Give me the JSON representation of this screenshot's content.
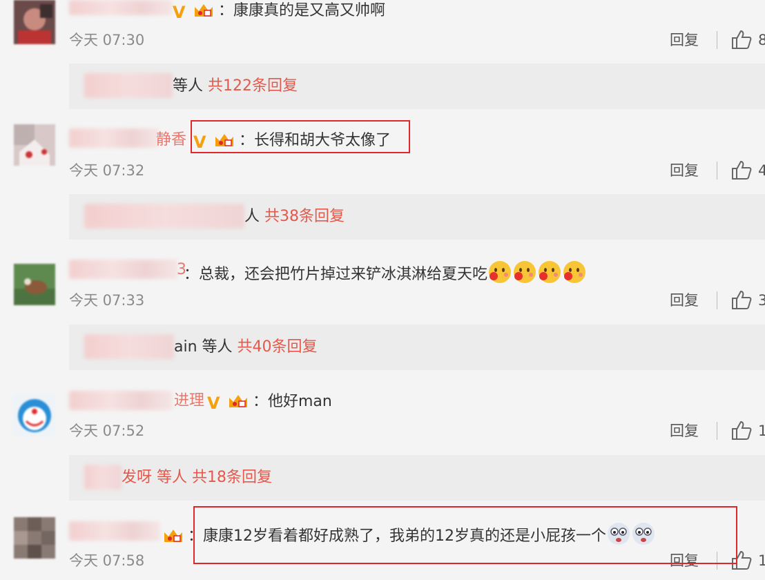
{
  "comments": [
    {
      "name_tail": "",
      "text": "：康康真的是又高又帅啊",
      "time": "今天 07:30",
      "reply_label": "回复",
      "likes": "8",
      "sub_tail": "等人",
      "sub_count": "共122条回复",
      "sub_name": "感宝贝超甜"
    },
    {
      "name_tail": "静香",
      "text": "：长得和胡大爷太像了",
      "time": "今天 07:32",
      "reply_label": "回复",
      "likes": "4",
      "sub_tail": "人",
      "sub_count": "共38条回复"
    },
    {
      "name_tail": "3",
      "text": "：总裁，还会把竹片掉过来铲冰淇淋给夏天吃",
      "time": "今天 07:33",
      "reply_label": "回复",
      "likes": "3",
      "sub_tail": "ain 等人",
      "sub_count": "共40条回复"
    },
    {
      "name_tail": "进理",
      "text": "：他好man",
      "time": "今天 07:52",
      "reply_label": "回复",
      "likes": "1",
      "sub_tail": "发呀 等人",
      "sub_count": "共18条回复"
    },
    {
      "name_tail": "",
      "text": "：康康12岁看着都好成熟了，我弟的12岁真的还是小屁孩一个",
      "time": "今天 07:58",
      "reply_label": "回复",
      "likes": "1"
    }
  ],
  "colors": {
    "highlight_border": "#e0262a",
    "link": "#e3594c",
    "vip_badge": "#f5a00f"
  }
}
